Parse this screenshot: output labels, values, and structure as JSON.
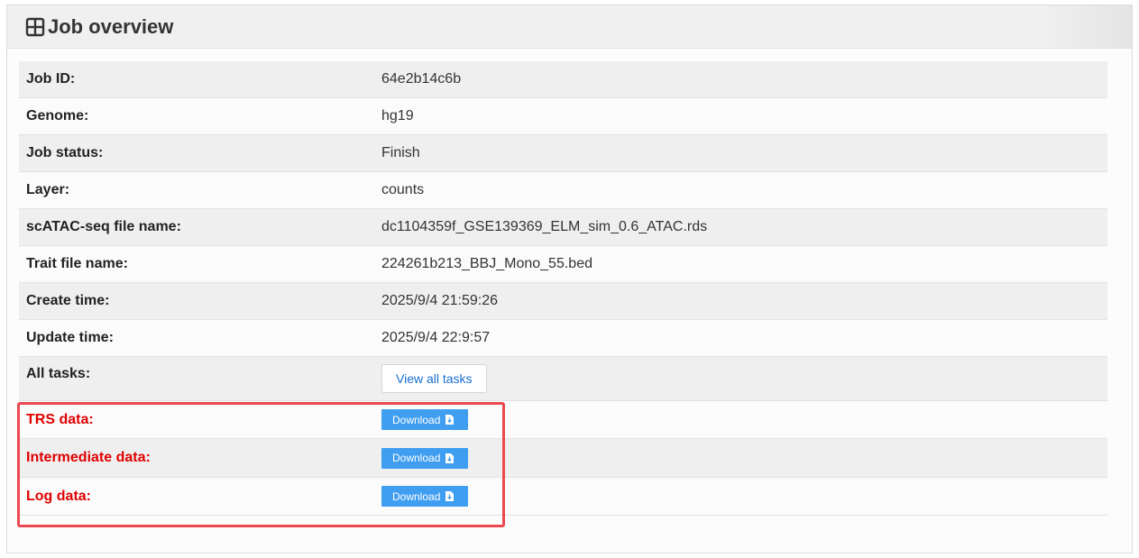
{
  "header": {
    "title": "Job overview",
    "icon": "table-icon"
  },
  "rows": [
    {
      "label": "Job ID:",
      "value": "64e2b14c6b"
    },
    {
      "label": "Genome:",
      "value": "hg19"
    },
    {
      "label": "Job status:",
      "value": "Finish"
    },
    {
      "label": "Layer:",
      "value": "counts"
    },
    {
      "label": "scATAC-seq file name:",
      "value": "dc1104359f_GSE139369_ELM_sim_0.6_ATAC.rds"
    },
    {
      "label": "Trait file name:",
      "value": "224261b213_BBJ_Mono_55.bed"
    },
    {
      "label": "Create time:",
      "value": "2025/9/4 21:59:26"
    },
    {
      "label": "Update time:",
      "value": "2025/9/4 22:9:57"
    }
  ],
  "all_tasks": {
    "label": "All tasks:",
    "button_label": "View all tasks"
  },
  "downloads": [
    {
      "label": "TRS data:",
      "button_label": "Download",
      "icon": "file-download-icon"
    },
    {
      "label": "Intermediate data:",
      "button_label": "Download",
      "icon": "file-download-icon"
    },
    {
      "label": "Log data:",
      "button_label": "Download",
      "icon": "file-download-icon"
    }
  ],
  "colors": {
    "download_button": "#3f9ef0",
    "highlight_border": "#ea4a4f",
    "download_label": "#e00000",
    "link": "#1a6fd1"
  }
}
